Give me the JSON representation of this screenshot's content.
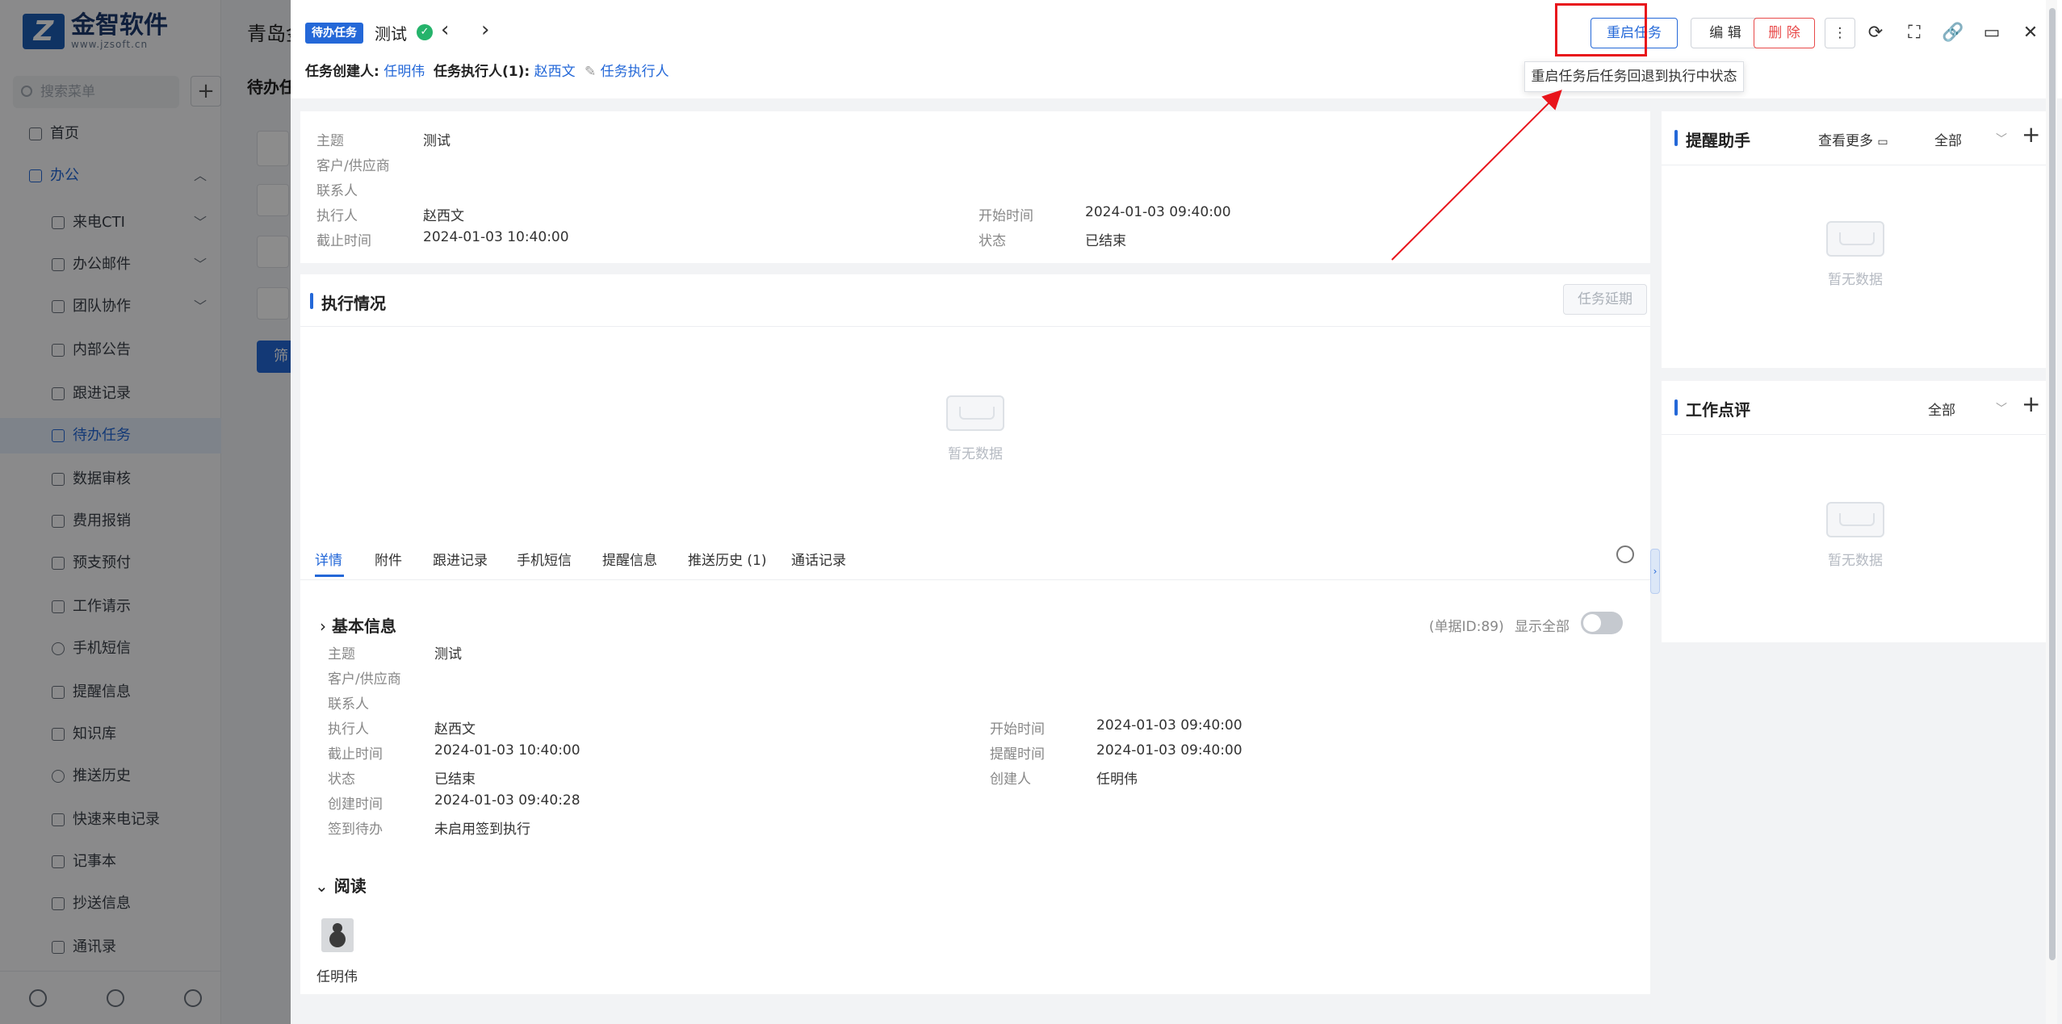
{
  "background": {
    "logo_name": "金智软件",
    "logo_url": "www.jzsoft.cn",
    "search_placeholder": "搜索菜单",
    "header_title": "青岛金",
    "tab_title": "待办任",
    "filter_button": "筛",
    "nav": [
      {
        "label": "首页"
      },
      {
        "label": "办公"
      },
      {
        "label": "来电CTI"
      },
      {
        "label": "办公邮件"
      },
      {
        "label": "团队协作"
      },
      {
        "label": "内部公告"
      },
      {
        "label": "跟进记录"
      },
      {
        "label": "待办任务"
      },
      {
        "label": "数据审核"
      },
      {
        "label": "费用报销"
      },
      {
        "label": "预支预付"
      },
      {
        "label": "工作请示"
      },
      {
        "label": "手机短信"
      },
      {
        "label": "提醒信息"
      },
      {
        "label": "知识库"
      },
      {
        "label": "推送历史"
      },
      {
        "label": "快速来电记录"
      },
      {
        "label": "记事本"
      },
      {
        "label": "抄送信息"
      },
      {
        "label": "通讯录"
      }
    ]
  },
  "header": {
    "tag": "待办任务",
    "title": "测试",
    "creator_label": "任务创建人:",
    "creator": "任明伟",
    "executor_label": "任务执行人(1):",
    "executor": "赵西文",
    "edit_executor": "任务执行人",
    "restart_button": "重启任务",
    "edit_button": "编 辑",
    "delete_button": "删 除",
    "tooltip": "重启任务后任务回退到执行中状态"
  },
  "summary": {
    "subject_label": "主题",
    "subject": "测试",
    "customer_label": "客户/供应商",
    "contact_label": "联系人",
    "executor_label": "执行人",
    "executor": "赵西文",
    "deadline_label": "截止时间",
    "deadline": "2024-01-03 10:40:00",
    "start_label": "开始时间",
    "start": "2024-01-03 09:40:00",
    "status_label": "状态",
    "status": "已结束"
  },
  "execution": {
    "title": "执行情况",
    "delay_button": "任务延期",
    "empty": "暂无数据"
  },
  "tabs": [
    {
      "label": "详情"
    },
    {
      "label": "附件"
    },
    {
      "label": "跟进记录"
    },
    {
      "label": "手机短信"
    },
    {
      "label": "提醒信息"
    },
    {
      "label": "推送历史 (1)"
    },
    {
      "label": "通话记录"
    }
  ],
  "basic": {
    "title": "基本信息",
    "doc_id": "(单据ID:89)",
    "show_all": "显示全部",
    "subject_label": "主题",
    "subject": "测试",
    "customer_label": "客户/供应商",
    "contact_label": "联系人",
    "executor_label": "执行人",
    "executor": "赵西文",
    "deadline_label": "截止时间",
    "deadline": "2024-01-03 10:40:00",
    "status_label": "状态",
    "status": "已结束",
    "created_label": "创建时间",
    "created": "2024-01-03 09:40:28",
    "checkin_label": "签到待办",
    "checkin": "未启用签到执行",
    "start_label": "开始时间",
    "start": "2024-01-03 09:40:00",
    "remind_label": "提醒时间",
    "remind": "2024-01-03 09:40:00",
    "creator_label": "创建人",
    "creator": "任明伟"
  },
  "read": {
    "title": "阅读",
    "user": "任明伟"
  },
  "reminder_panel": {
    "title": "提醒助手",
    "more": "查看更多",
    "filter": "全部",
    "empty": "暂无数据"
  },
  "review_panel": {
    "title": "工作点评",
    "filter": "全部",
    "empty": "暂无数据"
  },
  "colors": {
    "accent": "#2468d8",
    "danger": "#e84a4a",
    "highlight": "#e8141b"
  }
}
